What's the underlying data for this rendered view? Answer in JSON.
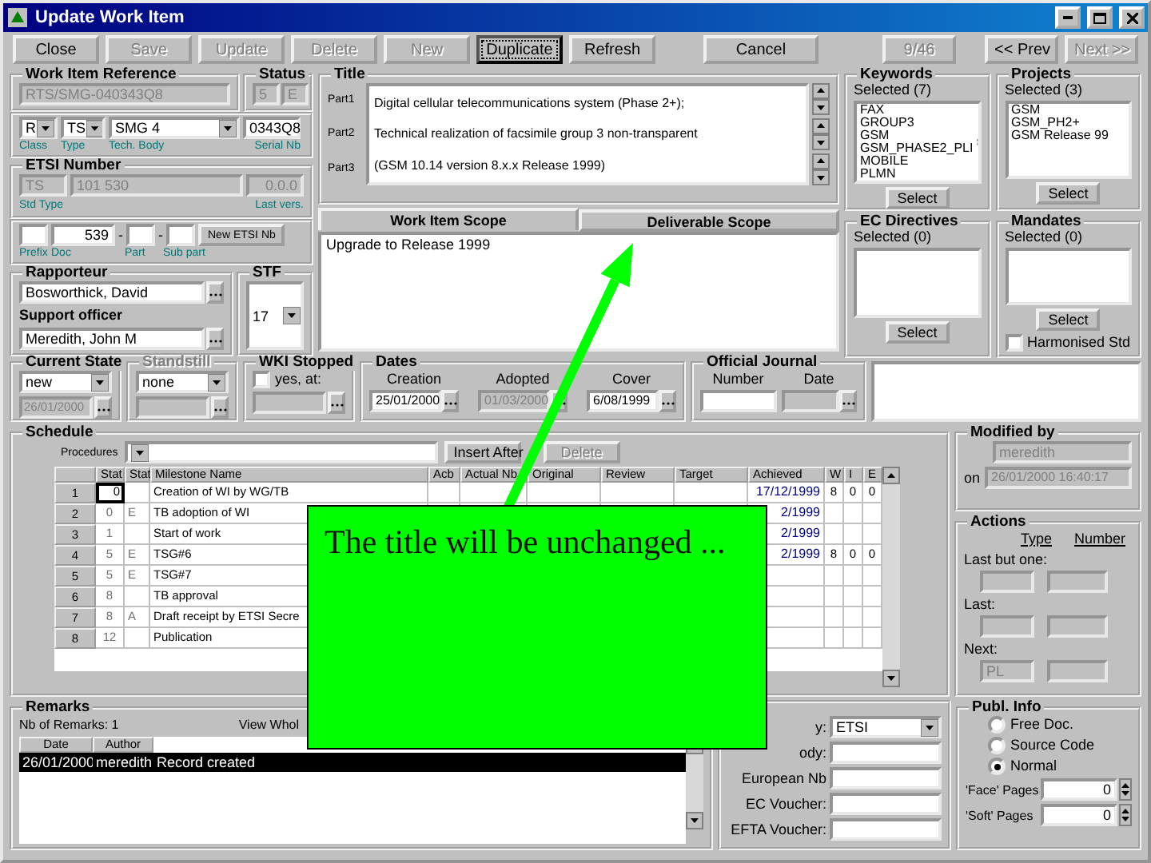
{
  "window": {
    "title": "Update Work Item"
  },
  "toolbar": {
    "buttons": [
      {
        "label": "Close",
        "disabled": false,
        "focused": false
      },
      {
        "label": "Save",
        "disabled": true,
        "focused": false
      },
      {
        "label": "Update",
        "disabled": true,
        "focused": false
      },
      {
        "label": "Delete",
        "disabled": true,
        "focused": false
      },
      {
        "label": "New",
        "disabled": true,
        "focused": false
      },
      {
        "label": "Duplicate",
        "disabled": false,
        "focused": true
      },
      {
        "label": "Refresh",
        "disabled": false,
        "focused": false
      },
      {
        "label": "Cancel",
        "disabled": false,
        "focused": false
      }
    ],
    "record_counter": "9/46",
    "nav_buttons": [
      {
        "label": "<< Prev",
        "disabled": false
      },
      {
        "label": "Next >>",
        "disabled": true
      }
    ]
  },
  "work_item_reference": {
    "title": "Work Item Reference",
    "value": "RTS/SMG-040343Q8"
  },
  "status": {
    "title": "Status",
    "values": [
      "5",
      "E"
    ]
  },
  "classification": [
    {
      "kind": "dropdown",
      "value": "R",
      "caption": "Class"
    },
    {
      "kind": "dropdown",
      "value": "TS",
      "caption": "Type"
    },
    {
      "kind": "dropdown",
      "value": "SMG 4",
      "caption": "Tech. Body"
    },
    {
      "kind": "text",
      "value": "0343Q8",
      "caption": "Serial Nb"
    }
  ],
  "etsi_number": {
    "title": "ETSI Number",
    "std_type": "TS",
    "number": "101 530",
    "last_version": "0.0.0",
    "captions": [
      "Std Type",
      "Last vers."
    ]
  },
  "doc_number": {
    "fields": [
      {
        "caption": "Prefix"
      },
      {
        "caption": "Doc",
        "value": "539"
      },
      {
        "caption": "Part"
      },
      {
        "caption": "Sub part"
      }
    ],
    "separators": [
      "-",
      "-"
    ],
    "button": "New ETSI Nb"
  },
  "rapporteur": {
    "title": "Rapporteur",
    "value": "Bosworthick, David"
  },
  "stf": {
    "title": "STF",
    "value": "17"
  },
  "support_officer": {
    "label": "Support officer",
    "value": "Meredith, John M"
  },
  "title": {
    "title": "Title",
    "parts": [
      {
        "label": "Part1",
        "value": "Digital cellular telecommunications system (Phase 2+);"
      },
      {
        "label": "Part2",
        "value": "Technical realization of facsimile group 3 non-transparent"
      },
      {
        "label": "Part3",
        "value": "(GSM 10.14 version 8.x.x Release 1999)"
      }
    ]
  },
  "scope_tabs": [
    {
      "label": "Work Item Scope",
      "selected": true
    },
    {
      "label": "Deliverable Scope",
      "selected": false
    }
  ],
  "scope_text": "Upgrade to Release 1999",
  "keywords": {
    "title": "Keywords",
    "count": "Selected (7)",
    "items": [
      "FAX",
      "GROUP3",
      "GSM",
      "GSM_PHASE2_PLI",
      "MOBILE",
      "PLMN"
    ],
    "button": "Select"
  },
  "projects": {
    "title": "Projects",
    "count": "Selected (3)",
    "items": [
      "GSM",
      "GSM_PH2+",
      "GSM Release 99"
    ],
    "button": "Select"
  },
  "ec_directives": {
    "title": "EC Directives",
    "count": "Selected (0)",
    "button": "Select"
  },
  "mandates": {
    "title": "Mandates",
    "count": "Selected (0)",
    "button": "Select",
    "harmonised": {
      "label": "Harmonised Std",
      "checked": false
    }
  },
  "current_state": {
    "title": "Current State",
    "state": "new",
    "date": "26/01/2000"
  },
  "standstill": {
    "title": "Standstill",
    "value": "none",
    "disabled": true
  },
  "wki_stopped": {
    "title": "WKI Stopped",
    "label": "yes, at:",
    "checked": false
  },
  "dates": {
    "title": "Dates",
    "fields": [
      {
        "label": "Creation",
        "value": "25/01/2000",
        "disabled": false
      },
      {
        "label": "Adopted",
        "value": "01/03/2000",
        "disabled": true
      },
      {
        "label": "Cover",
        "value": "6/08/1999",
        "disabled": false
      }
    ]
  },
  "official_journal": {
    "title": "Official Journal",
    "labels": [
      "Number",
      "Date"
    ]
  },
  "schedule": {
    "title": "Schedule",
    "procedures_label": "Procedures",
    "buttons": [
      {
        "label": "Insert After",
        "disabled": false
      },
      {
        "label": "Delete",
        "disabled": true
      }
    ],
    "columns": [
      "Stat",
      "Stat",
      "Milestone Name",
      "Acb",
      "Actual Nb",
      "Original",
      "Review",
      "Target",
      "Achieved",
      "W",
      "I",
      "E"
    ],
    "rows": [
      {
        "num": "1",
        "stat": "0",
        "name": "Creation of WI by WG/TB",
        "achieved": "17/12/1999",
        "w": "8",
        "i": "0",
        "e": "0",
        "selected": true
      },
      {
        "num": "2",
        "stat": "0",
        "flag": "E",
        "name": "TB adoption of WI",
        "achieved": "2/1999",
        "selected": false
      },
      {
        "num": "3",
        "stat": "1",
        "name": "Start of work",
        "achieved": "2/1999",
        "selected": false
      },
      {
        "num": "4",
        "stat": "5",
        "flag": "E",
        "name": "TSG#6",
        "achieved": "2/1999",
        "w": "8",
        "i": "0",
        "e": "0",
        "selected": false
      },
      {
        "num": "5",
        "stat": "5",
        "flag": "E",
        "name": "TSG#7",
        "selected": false
      },
      {
        "num": "6",
        "stat": "8",
        "name": "TB approval",
        "selected": false
      },
      {
        "num": "7",
        "stat": "8",
        "flag": "A",
        "name": "Draft receipt by ETSI Secre",
        "selected": false
      },
      {
        "num": "8",
        "stat": "12",
        "name": "Publication",
        "selected": false
      }
    ]
  },
  "remarks": {
    "title": "Remarks",
    "count": "Nb of Remarks: 1",
    "view": "View Whol",
    "columns": [
      "Date",
      "Author"
    ],
    "rows": [
      {
        "date": "26/01/2000",
        "author": "meredith",
        "text": "Record created",
        "selected": true
      }
    ]
  },
  "publication": [
    {
      "kind": "dropdown",
      "label": "y:",
      "value": "ETSI"
    },
    {
      "kind": "text",
      "label": "ody:"
    },
    {
      "kind": "text",
      "label": "European Nb"
    },
    {
      "kind": "text",
      "label": "EC Voucher:"
    },
    {
      "kind": "text",
      "label": "EFTA Voucher:"
    }
  ],
  "modified_by": {
    "title": "Modified by",
    "user": "meredith",
    "on_label": "on",
    "timestamp": "26/01/2000 16:40:17"
  },
  "actions": {
    "title": "Actions",
    "columns": [
      "Type",
      "Number"
    ],
    "rows": [
      {
        "label": "Last but one:"
      },
      {
        "label": "Last:"
      },
      {
        "label": "Next:",
        "type": "PL"
      }
    ]
  },
  "publ_info": {
    "title": "Publ. Info",
    "options": [
      {
        "label": "Free Doc.",
        "selected": false
      },
      {
        "label": "Source Code",
        "selected": false
      },
      {
        "label": "Normal",
        "selected": true
      }
    ],
    "spinners": [
      {
        "label": "'Face' Pages",
        "value": "0"
      },
      {
        "label": "'Soft' Pages",
        "value": "0"
      }
    ]
  },
  "callout": {
    "text": "The title will be unchanged ..."
  }
}
